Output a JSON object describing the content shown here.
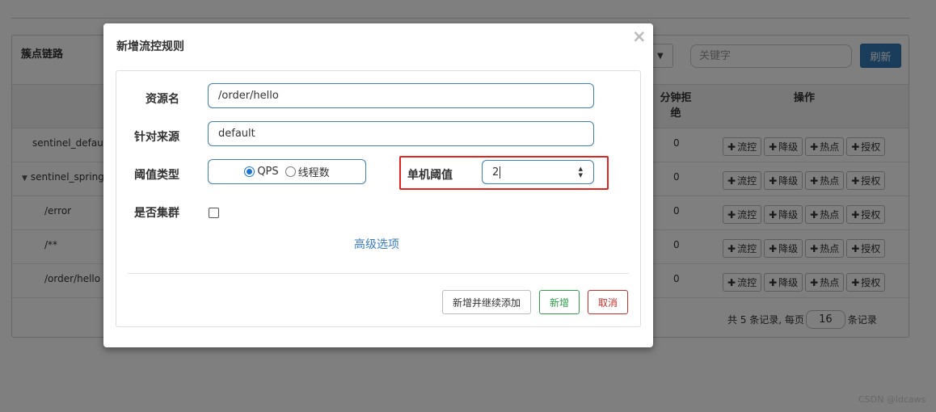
{
  "background": {
    "panel_title": "簇点链路",
    "keyword_placeholder": "关键字",
    "refresh_label": "刷新",
    "header_reject_label": "分钟拒绝",
    "header_ops_label": "操作",
    "rows": [
      {
        "name": "sentinel_default_",
        "value": "0",
        "indent": 1,
        "caret": false
      },
      {
        "name": "sentinel_spring_",
        "value": "0",
        "indent": 0,
        "caret": true
      },
      {
        "name": "/error",
        "value": "0",
        "indent": 2,
        "caret": false
      },
      {
        "name": "/**",
        "value": "0",
        "indent": 2,
        "caret": false
      },
      {
        "name": "/order/hello",
        "value": "0",
        "indent": 2,
        "caret": false
      }
    ],
    "row_actions": [
      "流控",
      "降级",
      "热点",
      "授权"
    ],
    "pager_prefix": "共 5 条记录, 每页",
    "page_size": "16",
    "pager_suffix": "条记录"
  },
  "modal": {
    "title": "新增流控规则",
    "close_glyph": "×",
    "resource_label": "资源名",
    "resource_value": "/order/hello",
    "origin_label": "针对来源",
    "origin_value": "default",
    "threshold_type_label": "阈值类型",
    "threshold_type_options": [
      "QPS",
      "线程数"
    ],
    "threshold_type_selected": "QPS",
    "threshold_label": "单机阈值",
    "threshold_value": "2",
    "cluster_label": "是否集群",
    "advanced_link": "高级选项",
    "btn_add_continue": "新增并继续添加",
    "btn_add": "新增",
    "btn_cancel": "取消"
  },
  "colors": {
    "primary": "#337ab7",
    "input_border": "#3d7fb8",
    "highlight_red": "#e0251f",
    "success": "#2f9d4a",
    "danger": "#c9302c"
  },
  "watermark": "CSDN @ldcaws"
}
